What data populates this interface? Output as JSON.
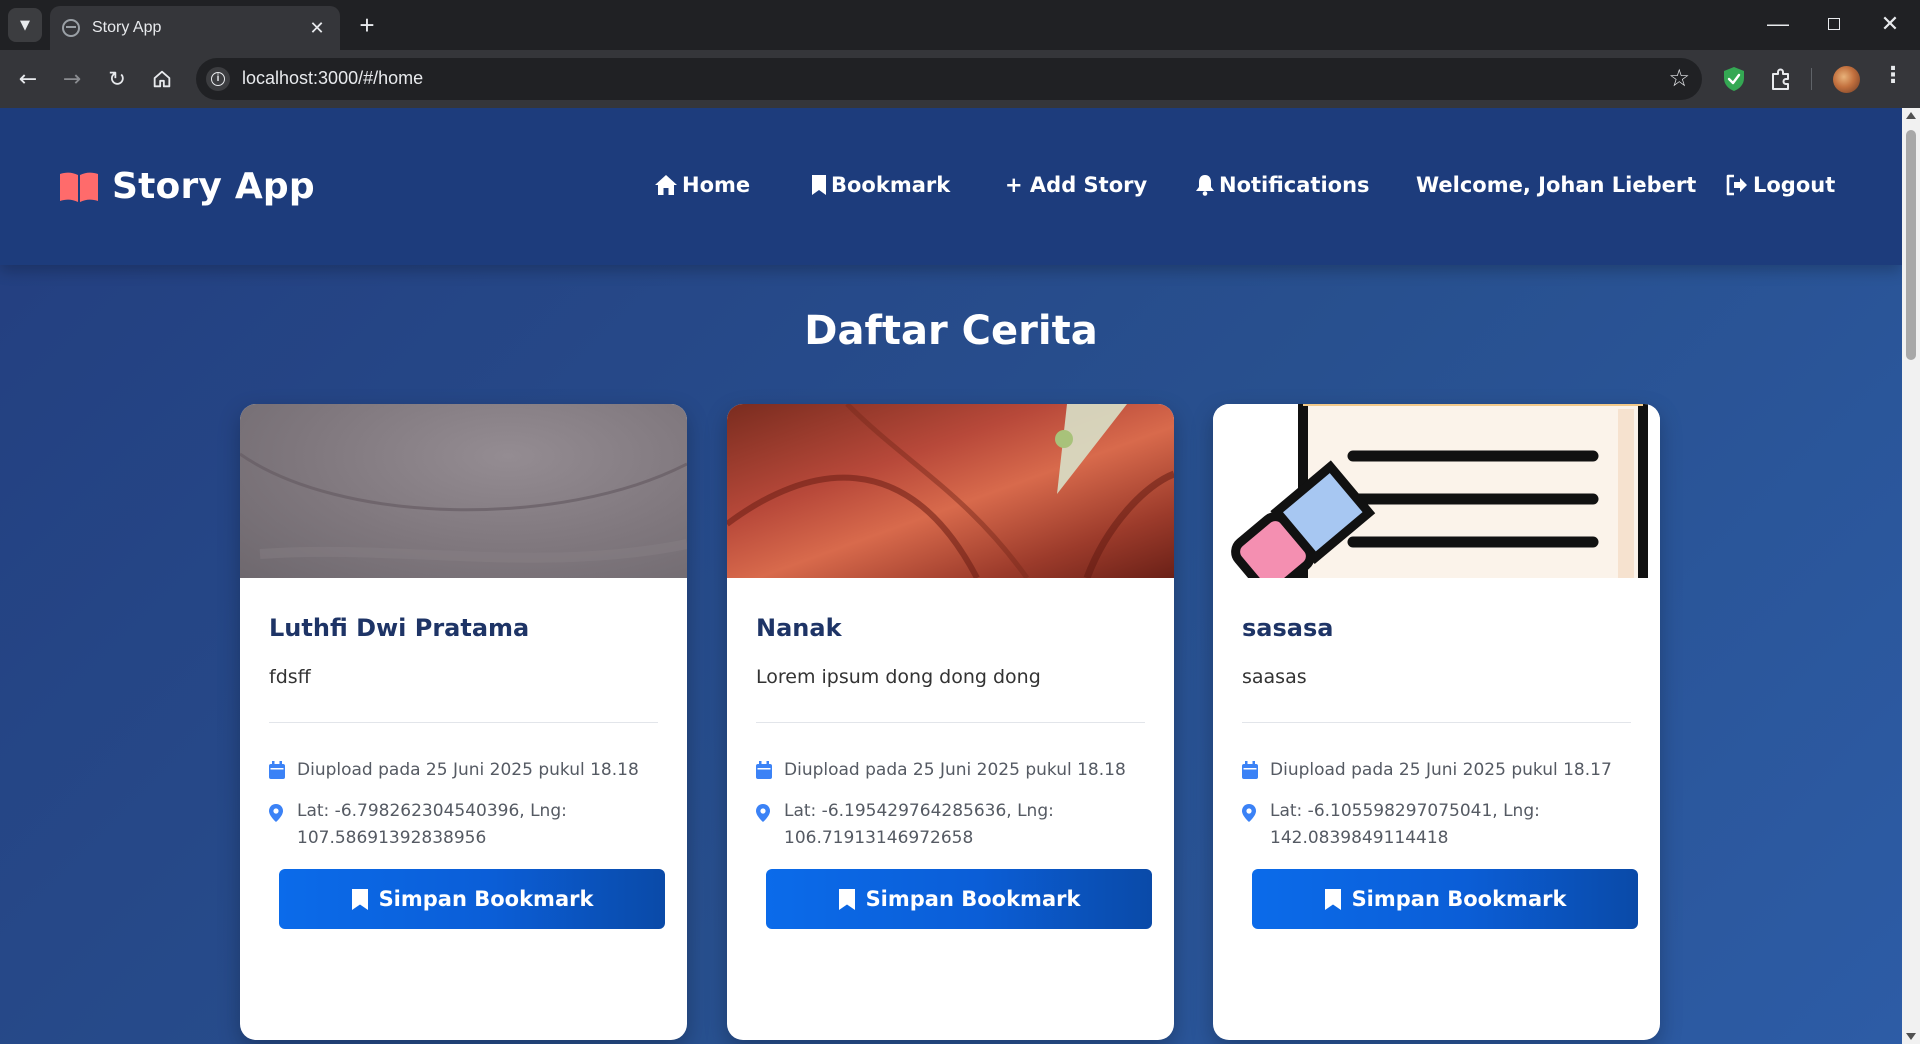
{
  "browser": {
    "tab_title": "Story App",
    "url": "localhost:3000/#/home"
  },
  "header": {
    "brand_title": "Story App",
    "nav": {
      "home": "Home",
      "bookmark": "Bookmark",
      "add_story": "+ Add Story",
      "notifications": "Notifications",
      "welcome": "Welcome, Johan Liebert",
      "logout": "Logout"
    }
  },
  "main": {
    "title": "Daftar Cerita",
    "stories": [
      {
        "name": "Luthfi Dwi Pratama",
        "description": "fdsff",
        "uploaded": "Diupload pada 25 Juni 2025 pukul 18.18",
        "location": "Lat: -6.798262304540396, Lng: 107.58691392838956",
        "button": "Simpan Bookmark"
      },
      {
        "name": "Nanak",
        "description": "Lorem ipsum dong dong dong",
        "uploaded": "Diupload pada 25 Juni 2025 pukul 18.18",
        "location": "Lat: -6.195429764285636, Lng: 106.71913146972658",
        "button": "Simpan Bookmark"
      },
      {
        "name": "sasasa",
        "description": "saasas",
        "uploaded": "Diupload pada 25 Juni 2025 pukul 18.17",
        "location": "Lat: -6.105598297075041, Lng: 142.0839849114418",
        "button": "Simpan Bookmark"
      }
    ]
  },
  "colors": {
    "header_bg": "#1d3c7c",
    "page_bg": "#28508f",
    "brand_icon": "#ff6b6b",
    "button_primary": "#0b6bea",
    "meta_icon": "#3b82f6",
    "card_title": "#1e3466"
  },
  "icons": {
    "brand": "open-book-icon",
    "home": "home-icon",
    "bookmark": "bookmark-icon",
    "notifications": "bell-icon",
    "logout": "logout-icon",
    "date": "calendar-icon",
    "location": "map-pin-icon"
  }
}
